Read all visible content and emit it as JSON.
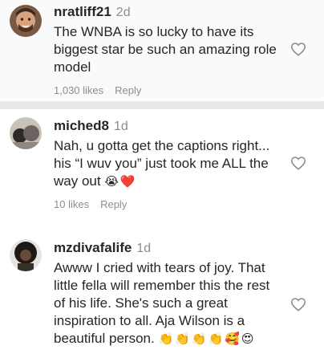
{
  "comments": [
    {
      "username": "nratliff21",
      "time": "2d",
      "text": "The WNBA is so lucky to have its biggest star be such an amazing role model",
      "likes": "1,030 likes",
      "reply": "Reply",
      "icon": "heart-outline-icon"
    },
    {
      "username": "miched8",
      "time": "1d",
      "text": "Nah, u gotta get the captions right... his “I wuv you” just took me ALL the way out",
      "emojis": "😭❤️",
      "likes": "10 likes",
      "reply": "Reply",
      "icon": "heart-outline-icon"
    },
    {
      "username": "mzdivafalife",
      "time": "1d",
      "text": "Awww I cried with tears of joy. That little fella will remember this the rest of his life. She's such a great inspiration to all. Aja Wilson is a beautiful person.",
      "emojis": "👏👏👏👏🥰😍",
      "icon": "heart-outline-icon"
    }
  ]
}
